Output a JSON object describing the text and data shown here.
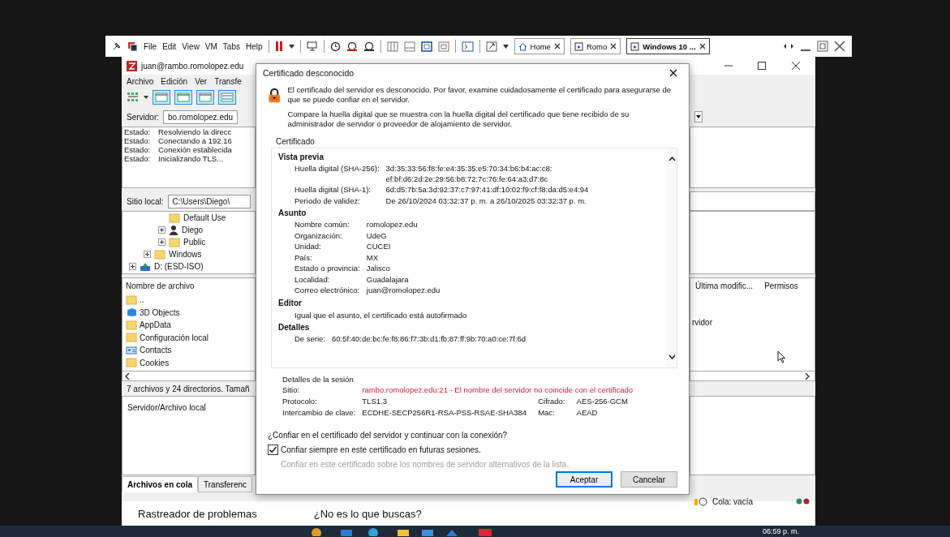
{
  "vm_toolbar": {
    "menus": [
      "File",
      "Edit",
      "View",
      "VM",
      "Tabs",
      "Help"
    ],
    "tabs": [
      {
        "label": "Home",
        "kind": "home",
        "selected": false
      },
      {
        "label": "Romo",
        "kind": "vm",
        "selected": false
      },
      {
        "label": "Windows 10 ...",
        "kind": "vm",
        "selected": true
      }
    ]
  },
  "filezilla": {
    "title": "juan@rambo.romolopez.edu",
    "menu": [
      "Archivo",
      "Edición",
      "Ver",
      "Transfe"
    ],
    "server_label": "Servidor:",
    "server_value": "bo.romolopez.edu",
    "log": [
      {
        "label": "Estado:",
        "message": "Resolviendo la direcc"
      },
      {
        "label": "Estado:",
        "message": "Conectando a 192.16"
      },
      {
        "label": "Estado:",
        "message": "Conexión establecida"
      },
      {
        "label": "Estado:",
        "message": "Inicializando TLS..."
      }
    ],
    "local_site_label": "Sitio local:",
    "local_site_value": "C:\\Users\\Diego\\",
    "tree": [
      {
        "children": [
          {
            "children": [
              {
                "label": "Default Use",
                "kind": "folder"
              },
              {
                "label": "Diego",
                "kind": "user",
                "expanded": false
              },
              {
                "label": "Public",
                "kind": "folder",
                "expanded": false
              }
            ]
          },
          {
            "label": "Windows",
            "kind": "folder",
            "expanded": false
          }
        ]
      },
      {
        "label": "D: (ESD-ISO)",
        "kind": "drive",
        "expanded": false
      }
    ],
    "local_columns": [
      "Nombre de archivo"
    ],
    "remote_columns": [
      "Última modific...",
      "Permisos"
    ],
    "files": [
      {
        "name": "..",
        "kind": "folder"
      },
      {
        "name": "3D Objects",
        "kind": "objects"
      },
      {
        "name": "AppData",
        "kind": "folder"
      },
      {
        "name": "Configuración local",
        "kind": "folder"
      },
      {
        "name": "Contacts",
        "kind": "contacts"
      },
      {
        "name": "Cookies",
        "kind": "folder"
      }
    ],
    "remote_text": "rvidor",
    "local_status": "7 archivos y 24 directorios. Tamañ",
    "queue_column": "Servidor/Archivo local",
    "queue_tabs": [
      {
        "label": "Archivos en cola",
        "selected": true
      },
      {
        "label": "Transferenc",
        "selected": false
      }
    ],
    "queue_status": "Cola: vacía"
  },
  "dialog": {
    "title": "Certificado desconocido",
    "intro": "El certificado del servidor es desconocido. Por favor, examine cuidadosamente el certificado para asegurarse de que se puede confiar en el servidor.",
    "compare": "Compare la huella digital que se muestra con la huella digital del certificado que tiene recibido de su administrador de servidor o proveedor de alojamiento de servidor.",
    "certificate_label": "Certificado",
    "sections": [
      {
        "heading": "Vista previa",
        "kind": "fields",
        "fields": [
          {
            "label": "Huella digital (SHA-256):",
            "lines": [
              "3d:35:33:56:f8:fe:e4:35:35:e5:70:34:b6:b4:ac:c8:",
              "ef:bf:d6:2d:2e:29:56:b8:72:7c:76:fe:64:a3:d7:8c"
            ]
          },
          {
            "label": "Huella digital (SHA-1):",
            "lines": [
              "6d:d5:7b:5a:3d:92:37:c7:97:41:df:10:02:f9:cf:f8:da:d5:e4:94"
            ]
          },
          {
            "label": "Periodo de validez:",
            "lines": [
              "De 26/10/2024 03:32:37 p. m. a 26/10/2025 03:32:37 p. m."
            ]
          }
        ]
      },
      {
        "heading": "Asunto",
        "kind": "fields",
        "fields": [
          {
            "label": "Nombre común:",
            "lines": [
              "romolopez.edu"
            ]
          },
          {
            "label": "Organización:",
            "lines": [
              "UdeG"
            ]
          },
          {
            "label": "Unidad:",
            "lines": [
              "CUCEI"
            ]
          },
          {
            "label": "País:",
            "lines": [
              "MX"
            ]
          },
          {
            "label": "Estado o provincia:",
            "lines": [
              "Jalisco"
            ]
          },
          {
            "label": "Localidad:",
            "lines": [
              "Guadalajara"
            ]
          },
          {
            "label": "Correo electrónico:",
            "lines": [
              "juan@romolopez.edu"
            ]
          }
        ]
      },
      {
        "heading": "Editor",
        "kind": "text",
        "text": "Igual que el asunto, el certificado está autofirmado"
      },
      {
        "heading": "Detalles",
        "kind": "fields",
        "fields": [
          {
            "label": "De serie:",
            "lines": [
              "60:5f:40:de:bc:fe:f8:86:f7:3b:d1:fb:87:ff:9b:70:a0:ce:7f:6d"
            ]
          }
        ]
      }
    ],
    "session_heading": "Detalles de la sesión",
    "site_label": "Sitio:",
    "site_value": "rambo.romolopez.edu:21 - El nombre del servidor no coincide con el certificado",
    "site_warning": true,
    "session_rows": [
      {
        "label": "Protocolo:",
        "value": "TLS1.3",
        "label_2": "Cifrado:",
        "value_2": "AES-256-GCM"
      },
      {
        "label": "Intercambio de clave:",
        "value": "ECDHE-SECP256R1-RSA-PSS-RSAE-SHA384",
        "label_2": "Mac:",
        "value_2": "AEAD"
      }
    ],
    "question": "¿Confiar en el certificado del servidor y continuar con la conexión?",
    "options": [
      {
        "label": "Confiar siempre en este certificado en futuras sesiones.",
        "checked": true,
        "disabled": false
      },
      {
        "label": "Confiar en este certificado sobre los nombres de servidor alternativos de la lista.",
        "disabled": true
      }
    ],
    "buttons": [
      {
        "label": "Aceptar",
        "selected": true
      },
      {
        "label": "Cancelar",
        "selected": false
      }
    ]
  },
  "background_page": {
    "heading": "Rastreador de problemas",
    "link": "¿No es lo que buscas?"
  },
  "taskbar": {
    "clock": "06:59 p. m."
  }
}
